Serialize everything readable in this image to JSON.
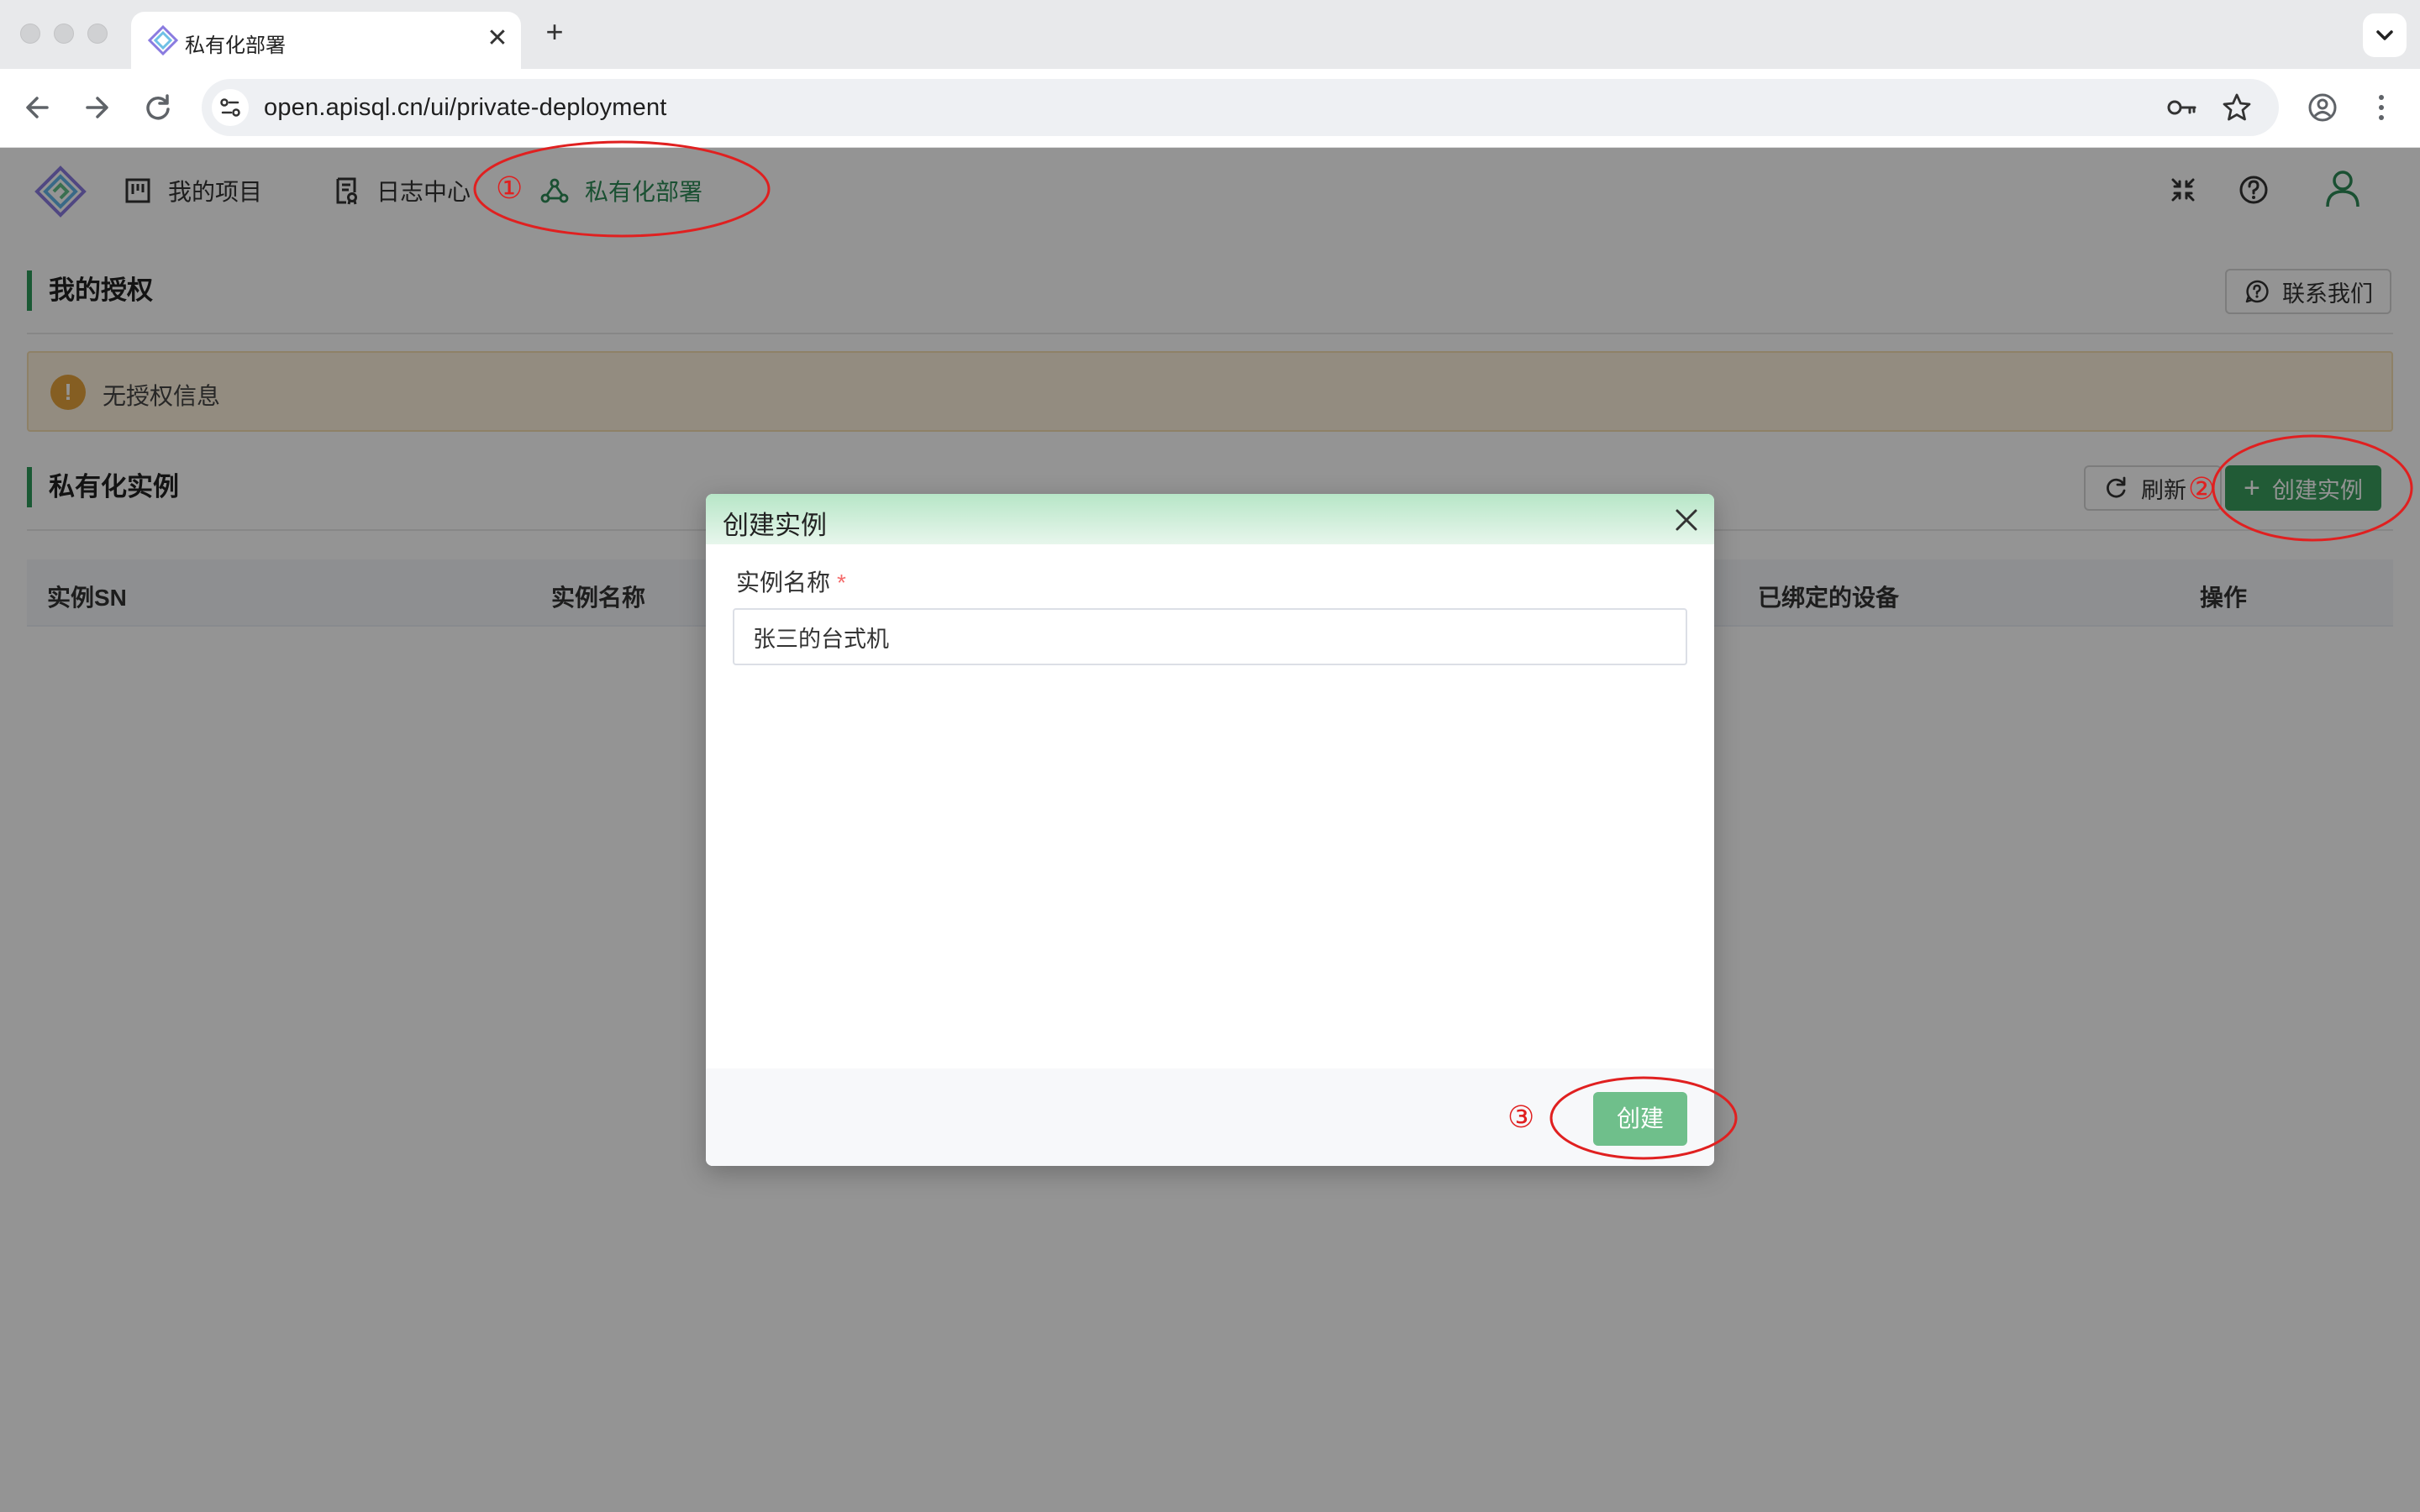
{
  "browser": {
    "tab_title": "私有化部署",
    "url": "open.apisql.cn/ui/private-deployment"
  },
  "header": {
    "nav": [
      {
        "label": "我的项目",
        "icon": "board-icon"
      },
      {
        "label": "日志中心",
        "icon": "log-icon"
      },
      {
        "label": "私有化部署",
        "icon": "share-nodes-icon",
        "active": true
      }
    ]
  },
  "license": {
    "title": "我的授权",
    "contact_label": "联系我们",
    "alert_text": "无授权信息"
  },
  "instances": {
    "title": "私有化实例",
    "refresh_label": "刷新",
    "create_label": "创建实例",
    "columns": [
      "实例SN",
      "实例名称",
      "已绑定的设备",
      "操作"
    ]
  },
  "modal": {
    "title": "创建实例",
    "field_label": "实例名称",
    "required_mark": "*",
    "field_value": "张三的台式机",
    "submit_label": "创建"
  },
  "annotations": {
    "step1": "①",
    "step2": "②",
    "step3": "③",
    "color": "#e02020"
  },
  "colors": {
    "accent": "#3a9d5d",
    "warning": "#e6a23c"
  }
}
